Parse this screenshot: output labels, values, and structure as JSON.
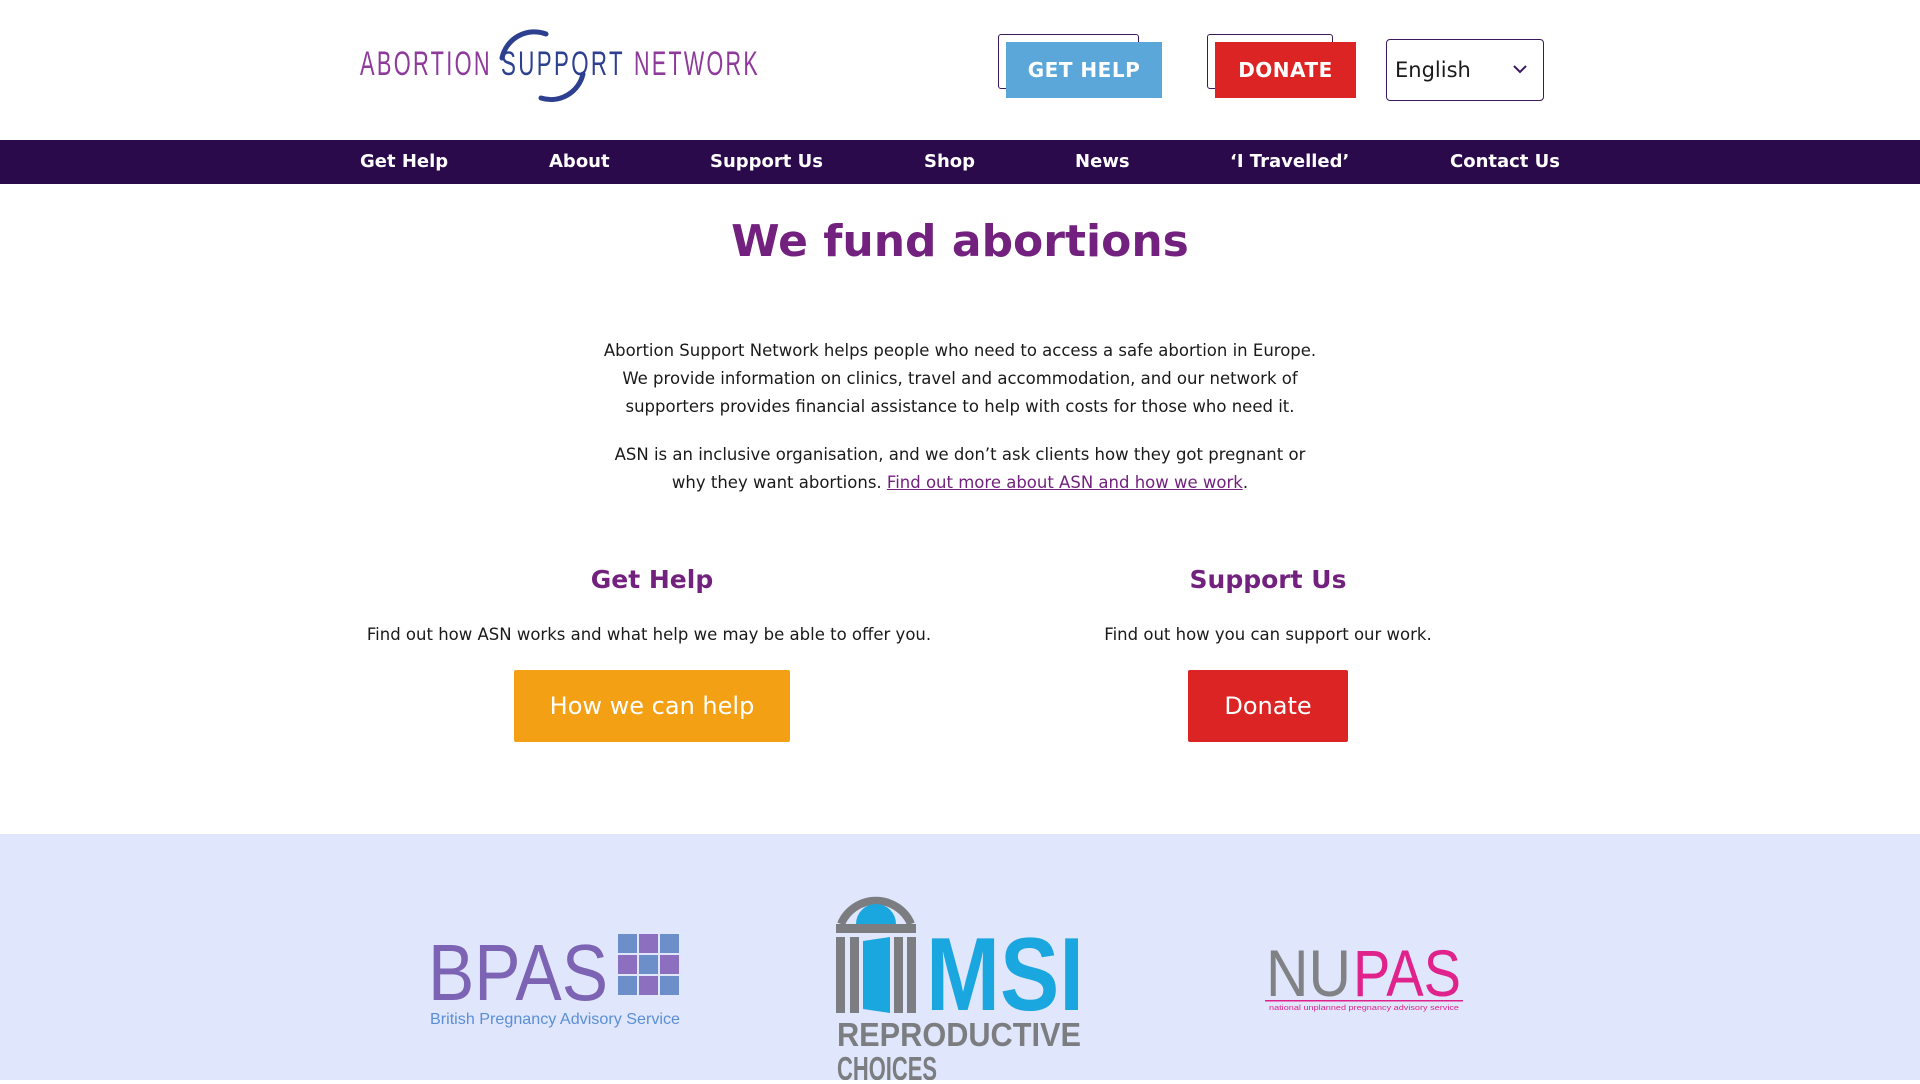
{
  "header": {
    "logo": {
      "word1": "ABORTION",
      "word2": "SUPPORT",
      "word3": "NETWORK",
      "color_purple": "#8e3a9b",
      "color_blue": "#2d3f8f"
    },
    "get_help_label": "GET HELP",
    "donate_label": "DONATE",
    "language": {
      "selected": "English",
      "icon": "chevron-down-icon"
    }
  },
  "nav": {
    "items": [
      {
        "label": "Get Help"
      },
      {
        "label": "About"
      },
      {
        "label": "Support Us"
      },
      {
        "label": "Shop"
      },
      {
        "label": "News"
      },
      {
        "label": "‘I Travelled’"
      },
      {
        "label": "Contact Us"
      }
    ]
  },
  "main": {
    "title": "We fund abortions",
    "intro1": {
      "line1": "Abortion Support Network helps people who need to access a safe abortion in Europe.",
      "line2": "We provide information on clinics, travel and accommodation, and our network of",
      "line3": "supporters provides financial assistance to help with costs for those who need it."
    },
    "intro2": {
      "line1": "ASN is an inclusive organisation, and we don’t ask clients how they got pregnant or",
      "line2_prefix": "why they want abortions. ",
      "link": "Find out more about ASN and how we work",
      "suffix": "."
    },
    "columns": {
      "help": {
        "title": "Get Help",
        "text": "Find out how ASN works and what help we may be able to offer you.",
        "button": "How we can help"
      },
      "support": {
        "title": "Support Us",
        "text": "Find out how you can support our work.",
        "button": "Donate"
      }
    }
  },
  "partners": {
    "bpas": {
      "name": "BPAS",
      "subtitle": "British Pregnancy Advisory Service"
    },
    "msi": {
      "name": "MSI",
      "line1": "REPRODUCTIVE",
      "line2": "CHOICES"
    },
    "nupas": {
      "name_part1": "NU",
      "name_part2": "PAS",
      "subtitle": "national unplanned pregnancy advisory service"
    }
  },
  "colors": {
    "accent_purple": "#73217e",
    "nav_bg": "#2a0a4a",
    "get_help_blue": "#5ba7d9",
    "donate_red": "#dd2424",
    "help_orange": "#f4a014",
    "partners_bg": "#e0e6fb"
  }
}
